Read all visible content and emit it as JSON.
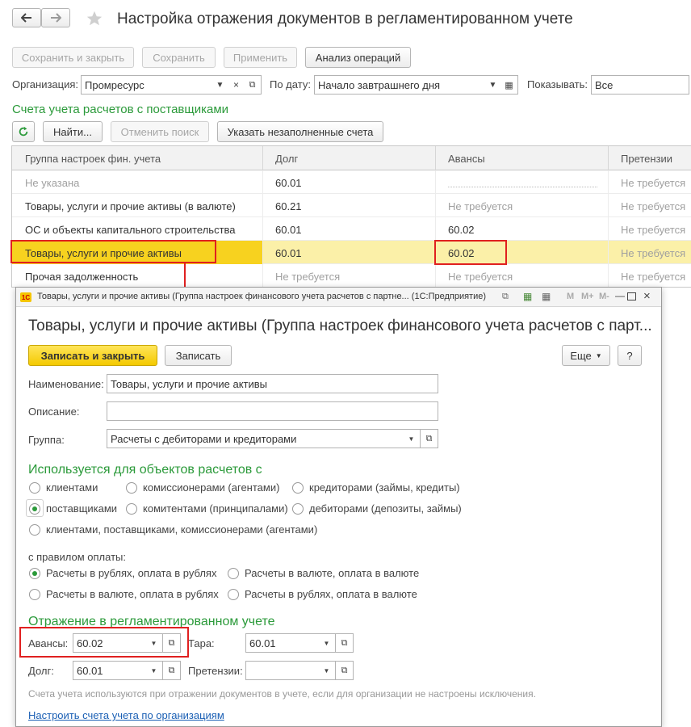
{
  "header": {
    "title": "Настройка отражения документов в регламентированном учете",
    "back_icon": "arrow-left-icon",
    "forward_icon": "arrow-right-icon",
    "favorite_icon": "star-icon"
  },
  "toolbar": {
    "save_close": "Сохранить и закрыть",
    "save": "Сохранить",
    "apply": "Применить",
    "analyze": "Анализ операций"
  },
  "filters": {
    "org_label": "Организация:",
    "org_value": "Промресурс",
    "date_label": "По дату:",
    "date_value": "Начало завтрашнего дня",
    "show_label": "Показывать:",
    "show_value": "Все"
  },
  "section": {
    "title": "Счета учета расчетов с поставщиками",
    "find": "Найти...",
    "cancel_search": "Отменить поиск",
    "show_empty": "Указать незаполненные счета"
  },
  "table": {
    "columns": [
      "Группа настроек фин. учета",
      "Долг",
      "Авансы",
      "Претензии"
    ],
    "rows": [
      {
        "group": "Не указана",
        "debt": "60.01",
        "advance": "",
        "claims": "Не требуется"
      },
      {
        "group": "Товары, услуги и прочие активы (в валюте)",
        "debt": "60.21",
        "advance": "Не требуется",
        "claims": "Не требуется"
      },
      {
        "group": "ОС и объекты капитального строительства",
        "debt": "60.01",
        "advance": "60.02",
        "claims": "Не требуется"
      },
      {
        "group": "Товары, услуги и прочие активы",
        "debt": "60.01",
        "advance": "60.02",
        "claims": "Не требуется"
      },
      {
        "group": "Прочая задолженность",
        "debt": "Не требуется",
        "advance": "Не требуется",
        "claims": "Не требуется"
      }
    ]
  },
  "dialog": {
    "titlebar": "Товары, услуги и прочие активы (Группа настроек финансового учета расчетов с партне... (1С:Предприятие)",
    "app_icon": "1c-logo-icon",
    "heading": "Товары, услуги и прочие активы (Группа настроек финансового учета расчетов с парт...",
    "write_close": "Записать и закрыть",
    "write": "Записать",
    "more": "Еще",
    "help": "?",
    "name_label": "Наименование:",
    "name_value": "Товары, услуги и прочие активы",
    "desc_label": "Описание:",
    "desc_value": "",
    "group_label": "Группа:",
    "group_value": "Расчеты с дебиторами и кредиторами",
    "used_for_title": "Используется для объектов расчетов с",
    "used_for_options": [
      "клиентами",
      "комиссионерами (агентами)",
      "кредиторами (займы, кредиты)",
      "поставщиками",
      "комитентами (принципалами)",
      "дебиторами (депозиты, займы)",
      "клиентами, поставщиками, комиссионерами (агентами)"
    ],
    "used_for_selected": "поставщиками",
    "payment_rule_label": "с правилом оплаты:",
    "payment_options": [
      "Расчеты в рублях, оплата в рублях",
      "Расчеты в валюте, оплата в валюте",
      "Расчеты в валюте, оплата в рублях",
      "Расчеты в рублях, оплата в валюте"
    ],
    "payment_selected": "Расчеты в рублях, оплата в рублях",
    "reflection_title": "Отражение в регламентированном учете",
    "advance_label": "Авансы:",
    "advance_value": "60.02",
    "tara_label": "Тара:",
    "tara_value": "60.01",
    "debt_label": "Долг:",
    "debt_value": "60.01",
    "claims_label": "Претензии:",
    "claims_value": "",
    "note": "Счета учета используются при отражении документов в учете, если для организации не настроены исключения.",
    "link": "Настроить счета учета по организациям"
  }
}
